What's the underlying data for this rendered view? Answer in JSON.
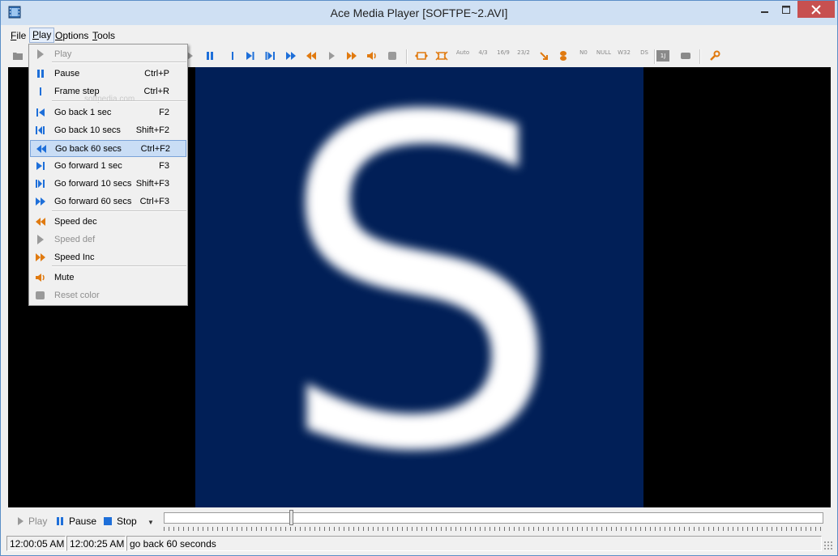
{
  "window": {
    "title": "Ace Media Player [SOFTPE~2.AVI]"
  },
  "menubar": {
    "items": [
      {
        "id": "file",
        "label": "File",
        "mnemonic": "F",
        "rest": "ile"
      },
      {
        "id": "play",
        "label": "Play",
        "mnemonic": "P",
        "rest": "lay"
      },
      {
        "id": "options",
        "label": "Options",
        "mnemonic": "O",
        "rest": "ptions"
      },
      {
        "id": "tools",
        "label": "Tools",
        "mnemonic": "T",
        "rest": "ools"
      }
    ],
    "active": "Play"
  },
  "toolbar": {
    "aspect_labels": [
      "Auto",
      "4/3",
      "16/9",
      "23/2"
    ],
    "audio_labels": [
      "N0",
      "NULL",
      "W32",
      "DS"
    ],
    "misc_label": "1J"
  },
  "play_menu": {
    "watermark": "softpedia.com",
    "items": [
      {
        "label": "Play",
        "shortcut": "",
        "icon": "play-icon",
        "disabled": true
      },
      {
        "label": "Pause",
        "shortcut": "Ctrl+P",
        "icon": "pause-icon",
        "disabled": false
      },
      {
        "label": "Frame step",
        "shortcut": "Ctrl+R",
        "icon": "frame-step-icon",
        "disabled": false
      },
      {
        "label": "Go back 1 sec",
        "shortcut": "F2",
        "icon": "skip-back-icon",
        "disabled": false
      },
      {
        "label": "Go back 10 secs",
        "shortcut": "Shift+F2",
        "icon": "skip-back-10-icon",
        "disabled": false
      },
      {
        "label": "Go back 60 secs",
        "shortcut": "Ctrl+F2",
        "icon": "rewind-icon",
        "disabled": false,
        "highlighted": true
      },
      {
        "label": "Go forward 1 sec",
        "shortcut": "F3",
        "icon": "skip-forward-icon",
        "disabled": false
      },
      {
        "label": "Go forward 10 secs",
        "shortcut": "Shift+F3",
        "icon": "skip-forward-10-icon",
        "disabled": false
      },
      {
        "label": "Go forward 60 secs",
        "shortcut": "Ctrl+F3",
        "icon": "fast-forward-icon",
        "disabled": false
      },
      {
        "label": "Speed dec",
        "shortcut": "",
        "icon": "speed-dec-icon",
        "disabled": false
      },
      {
        "label": "Speed def",
        "shortcut": "",
        "icon": "speed-def-icon",
        "disabled": true
      },
      {
        "label": "Speed Inc",
        "shortcut": "",
        "icon": "speed-inc-icon",
        "disabled": false
      },
      {
        "label": "Mute",
        "shortcut": "",
        "icon": "mute-icon",
        "disabled": false
      },
      {
        "label": "Reset color",
        "shortcut": "",
        "icon": "reset-color-icon",
        "disabled": true
      }
    ]
  },
  "video": {
    "letter": "S",
    "frame_color": "#011f57"
  },
  "controls": {
    "play_label": "Play",
    "pause_label": "Pause",
    "stop_label": "Stop",
    "seek_position": 0.19
  },
  "status": {
    "current_time": "12:00:05 AM",
    "total_time": "12:00:25 AM",
    "message": "go back 60 seconds"
  },
  "colors": {
    "accent_blue": "#1e6fd9",
    "accent_orange": "#e07a10",
    "highlight": "#c9ddf5",
    "close_red": "#c75050"
  }
}
